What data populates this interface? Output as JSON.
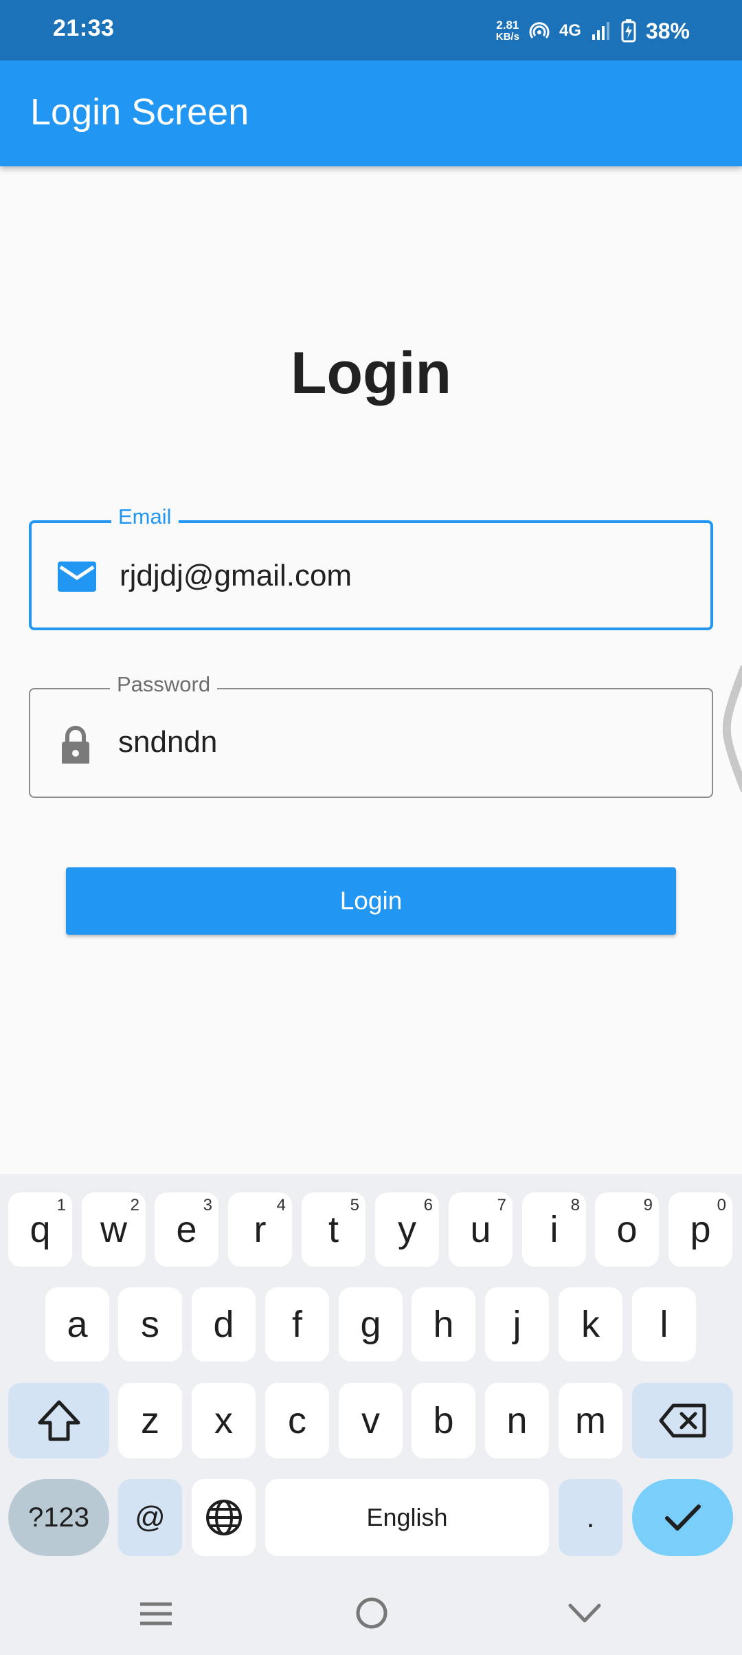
{
  "status_bar": {
    "time": "21:33",
    "net_speed_value": "2.81",
    "net_speed_unit": "KB/s",
    "network_type": "4G",
    "battery_percent": "38%"
  },
  "app_bar": {
    "title": "Login Screen"
  },
  "page": {
    "heading": "Login",
    "email": {
      "label": "Email",
      "value": "rjdjdj@gmail.com",
      "icon": "mail-icon"
    },
    "password": {
      "label": "Password",
      "value": "sndndn",
      "icon": "lock-icon"
    },
    "login_button": "Login"
  },
  "keyboard": {
    "row1": [
      {
        "key": "q",
        "hint": "1"
      },
      {
        "key": "w",
        "hint": "2"
      },
      {
        "key": "e",
        "hint": "3"
      },
      {
        "key": "r",
        "hint": "4"
      },
      {
        "key": "t",
        "hint": "5"
      },
      {
        "key": "y",
        "hint": "6"
      },
      {
        "key": "u",
        "hint": "7"
      },
      {
        "key": "i",
        "hint": "8"
      },
      {
        "key": "o",
        "hint": "9"
      },
      {
        "key": "p",
        "hint": "0"
      }
    ],
    "row2": [
      "a",
      "s",
      "d",
      "f",
      "g",
      "h",
      "j",
      "k",
      "l"
    ],
    "row3": [
      "z",
      "x",
      "c",
      "v",
      "b",
      "n",
      "m"
    ],
    "symbols_key": "?123",
    "at_key": "@",
    "space_label": "English",
    "period_key": "."
  },
  "colors": {
    "status_bar": "#1c72b8",
    "app_bar": "#2196f3",
    "accent": "#2196f3",
    "enter_key": "#79cffa"
  }
}
